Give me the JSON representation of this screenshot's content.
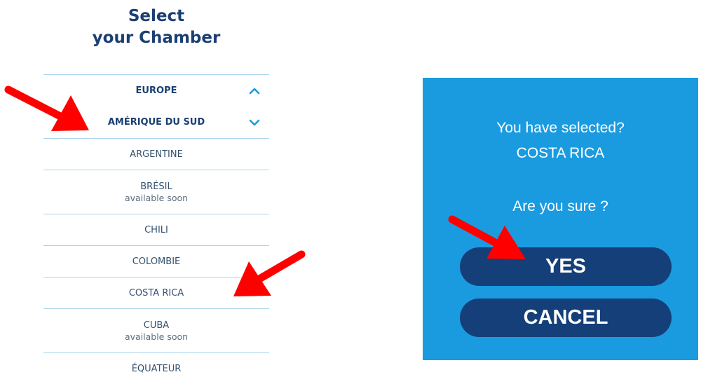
{
  "title": {
    "line1": "Select",
    "line2": "your Chamber"
  },
  "regions": [
    {
      "label": "EUROPE",
      "state": "expanded-up",
      "icon": "chevron-up-icon"
    },
    {
      "label": "AMÉRIQUE DU SUD",
      "state": "expanded",
      "icon": "chevron-down-icon"
    }
  ],
  "countries": [
    {
      "name": "ARGENTINE",
      "note": ""
    },
    {
      "name": "BRÉSIL",
      "note": "available soon"
    },
    {
      "name": "CHILI",
      "note": ""
    },
    {
      "name": "COLOMBIE",
      "note": ""
    },
    {
      "name": "COSTA RICA",
      "note": ""
    },
    {
      "name": "CUBA",
      "note": "available soon"
    },
    {
      "name": "ÉQUATEUR",
      "note": ""
    }
  ],
  "dialog": {
    "line1": "You have selected?",
    "selection": "COSTA RICA",
    "question": "Are you sure ?",
    "yes_label": "YES",
    "cancel_label": "CANCEL"
  },
  "colors": {
    "title": "#1b3f73",
    "divider": "#a9d4ec",
    "chevron": "#1a9be0",
    "panel": "#1a9be0",
    "button": "#143f78",
    "arrow": "#ff0000"
  }
}
